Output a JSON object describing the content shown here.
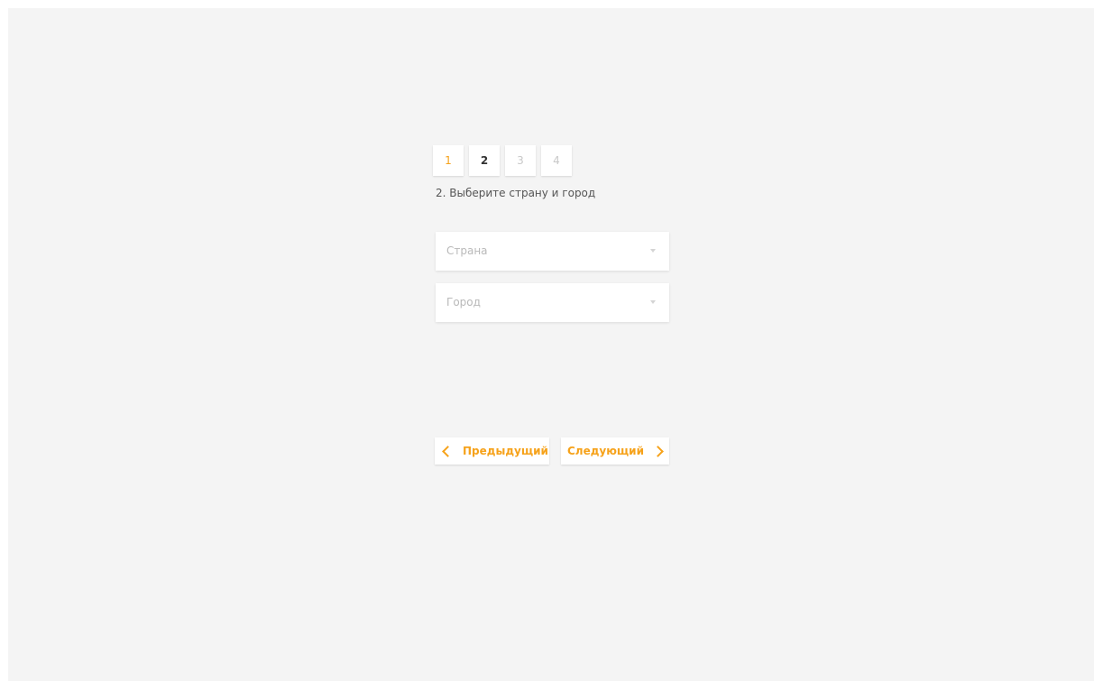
{
  "wizard": {
    "steps": [
      {
        "label": "1",
        "state": "done"
      },
      {
        "label": "2",
        "state": "active"
      },
      {
        "label": "3",
        "state": "upcoming"
      },
      {
        "label": "4",
        "state": "upcoming"
      }
    ],
    "current_step_title": "2. Выберите страну и город"
  },
  "form": {
    "country": {
      "placeholder": "Страна",
      "icon": "caret-down-icon"
    },
    "city": {
      "placeholder": "Город",
      "icon": "caret-down-icon"
    }
  },
  "navigation": {
    "prev_label": "Предыдущий",
    "prev_icon": "chevron-left-icon",
    "next_label": "Следующий",
    "next_icon": "chevron-right-icon"
  },
  "colors": {
    "accent": "#f6a21a",
    "background": "#f4f4f4",
    "surface": "#ffffff",
    "text": "#555555",
    "muted": "#c8c8c8"
  }
}
